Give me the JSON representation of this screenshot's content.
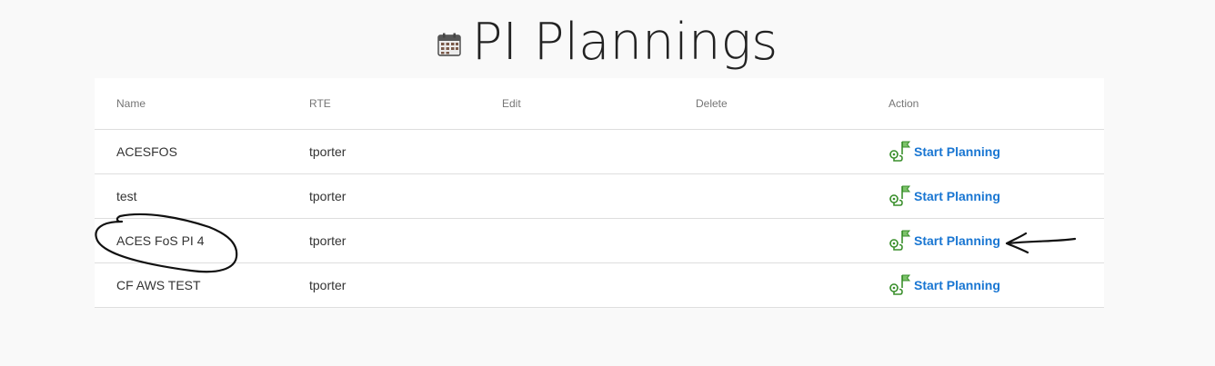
{
  "page": {
    "title": "PI Plannings",
    "icon": "calendar-icon"
  },
  "table": {
    "columns": [
      "Name",
      "RTE",
      "Edit",
      "Delete",
      "Action"
    ],
    "rows": [
      {
        "name": "ACESFOS",
        "rte": "tporter",
        "action_label": "Start Planning"
      },
      {
        "name": "test",
        "rte": "tporter",
        "action_label": "Start Planning"
      },
      {
        "name": "ACES FoS PI 4",
        "rte": "tporter",
        "action_label": "Start Planning"
      },
      {
        "name": "CF AWS TEST",
        "rte": "tporter",
        "action_label": "Start Planning"
      }
    ],
    "action_icon": "map-flag-icon"
  },
  "annotations": {
    "circle_target": "ACES FoS PI 4",
    "arrow_target": "Start Planning"
  },
  "colors": {
    "background": "#f9f9f9",
    "card": "#ffffff",
    "link": "#1976d2",
    "icon_green": "#3a8f2c",
    "divider": "#dedede"
  }
}
